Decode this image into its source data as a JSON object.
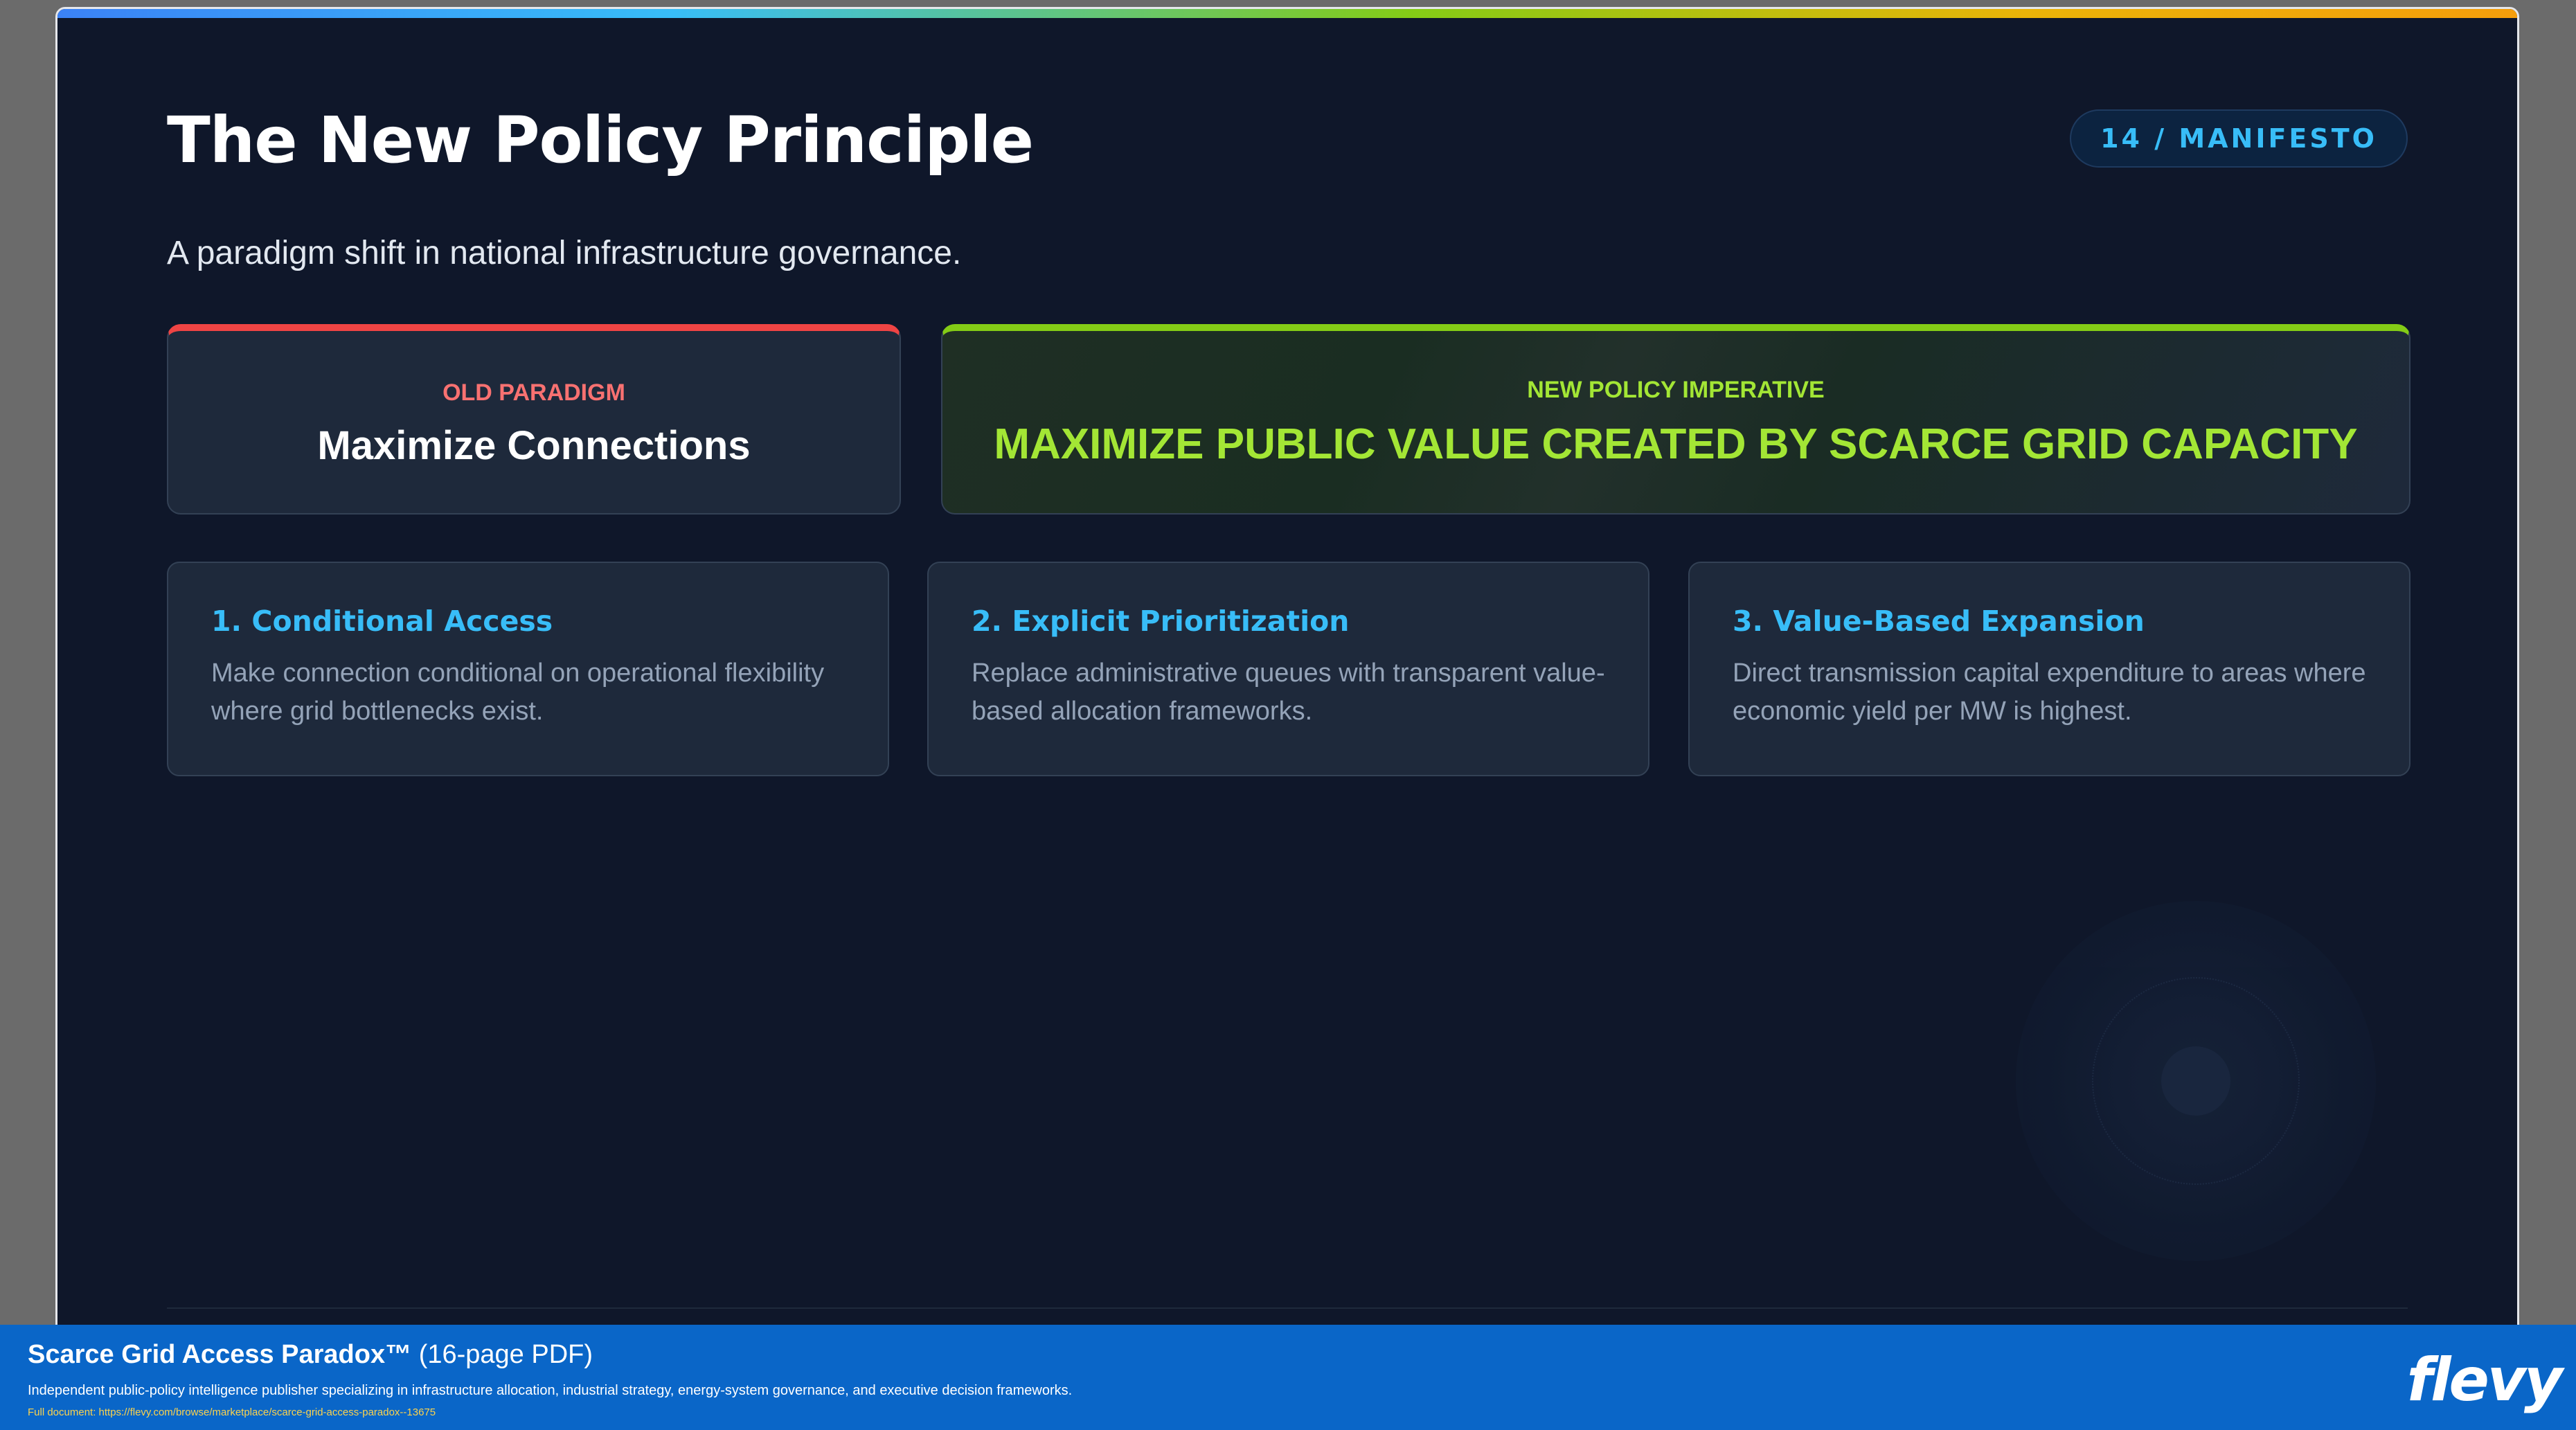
{
  "slide": {
    "title": "The New Policy Principle",
    "page_badge": "14 / MANIFESTO",
    "subtitle": "A paradigm shift in national infrastructure governance."
  },
  "comparison": {
    "old": {
      "label": "OLD PARADIGM",
      "heading": "Maximize Connections",
      "accent_color": "#ef4444"
    },
    "new": {
      "label": "NEW POLICY IMPERATIVE",
      "heading": "MAXIMIZE PUBLIC VALUE CREATED BY SCARCE GRID CAPACITY",
      "accent_color": "#84cc16"
    }
  },
  "cards": [
    {
      "title": "1. Conditional Access",
      "text": "Make connection conditional on operational flexibility where grid bottlenecks exist."
    },
    {
      "title": "2. Explicit Prioritization",
      "text": "Replace administrative queues with transparent value-based allocation frameworks."
    },
    {
      "title": "3. Value-Based Expansion",
      "text": "Direct transmission capital expenditure to areas where economic yield per MW is highest."
    }
  ],
  "footer": {
    "doc_name": "Scarce Grid Access Paradox™",
    "pages": "(16-page PDF)",
    "description": "Independent public-policy intelligence publisher specializing in infrastructure allocation, industrial strategy, energy-system governance, and executive decision frameworks.",
    "link": "Full document: https://flevy.com/browse/marketplace/scarce-grid-access-paradox--13675",
    "logo": "flevy"
  },
  "colors": {
    "background": "#0f172a",
    "card": "#1e293b",
    "accent_blue": "#38bdf8",
    "accent_green": "#a3e635",
    "accent_red": "#f87171",
    "footer_bar": "#0a66c8"
  }
}
